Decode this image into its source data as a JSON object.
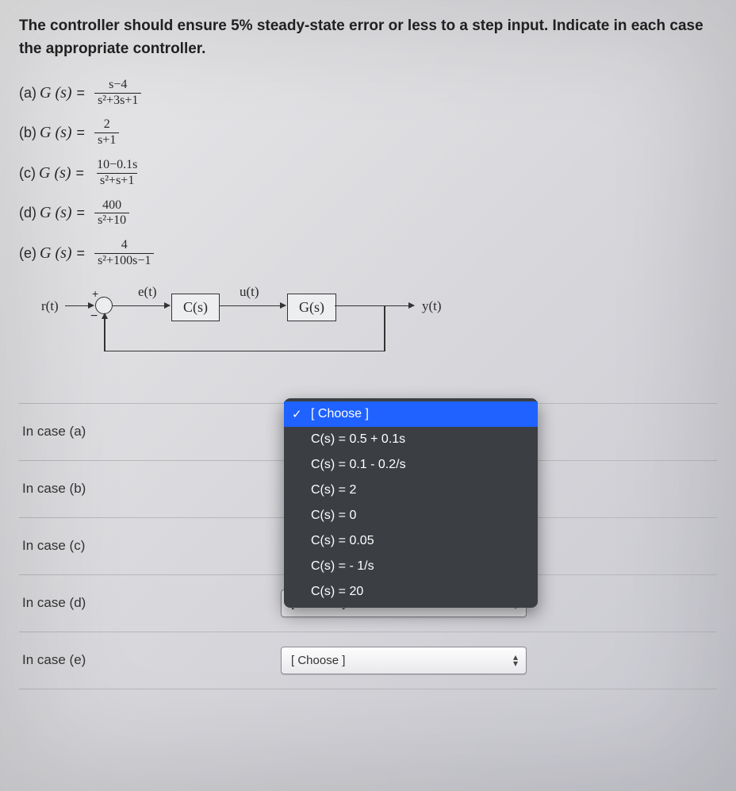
{
  "prompt": "The controller should ensure 5% steady-state error or less to a step input. Indicate in each case the appropriate controller.",
  "equations": {
    "a": {
      "label": "(a)",
      "lhs": "G (s)",
      "num": "s−4",
      "den": "s²+3s+1"
    },
    "b": {
      "label": "(b)",
      "lhs": "G (s)",
      "num": "2",
      "den": "s+1"
    },
    "c": {
      "label": "(c)",
      "lhs": "G (s)",
      "num": "10−0.1s",
      "den": "s²+s+1"
    },
    "d": {
      "label": "(d)",
      "lhs": "G (s)",
      "num": "400",
      "den": "s²+10"
    },
    "e": {
      "label": "(e)",
      "lhs": "G (s)",
      "num": "4",
      "den": "s²+100s−1"
    }
  },
  "diagram": {
    "r": "r(t)",
    "e": "e(t)",
    "u": "u(t)",
    "y": "y(t)",
    "C": "C(s)",
    "G": "G(s)",
    "plus": "+",
    "minus": "−"
  },
  "cases": {
    "a": "In case (a)",
    "b": "In case (b)",
    "c": "In case (c)",
    "d": "In case (d)",
    "e": "In case (e)"
  },
  "choose_placeholder": "[ Choose ]",
  "dropdown": {
    "selected": "[ Choose ]",
    "options": [
      "C(s) = 0.5 + 0.1s",
      "C(s) = 0.1 - 0.2/s",
      "C(s) = 2",
      "C(s) = 0",
      "C(s) = 0.05",
      "C(s) = - 1/s",
      "C(s) = 20"
    ]
  }
}
